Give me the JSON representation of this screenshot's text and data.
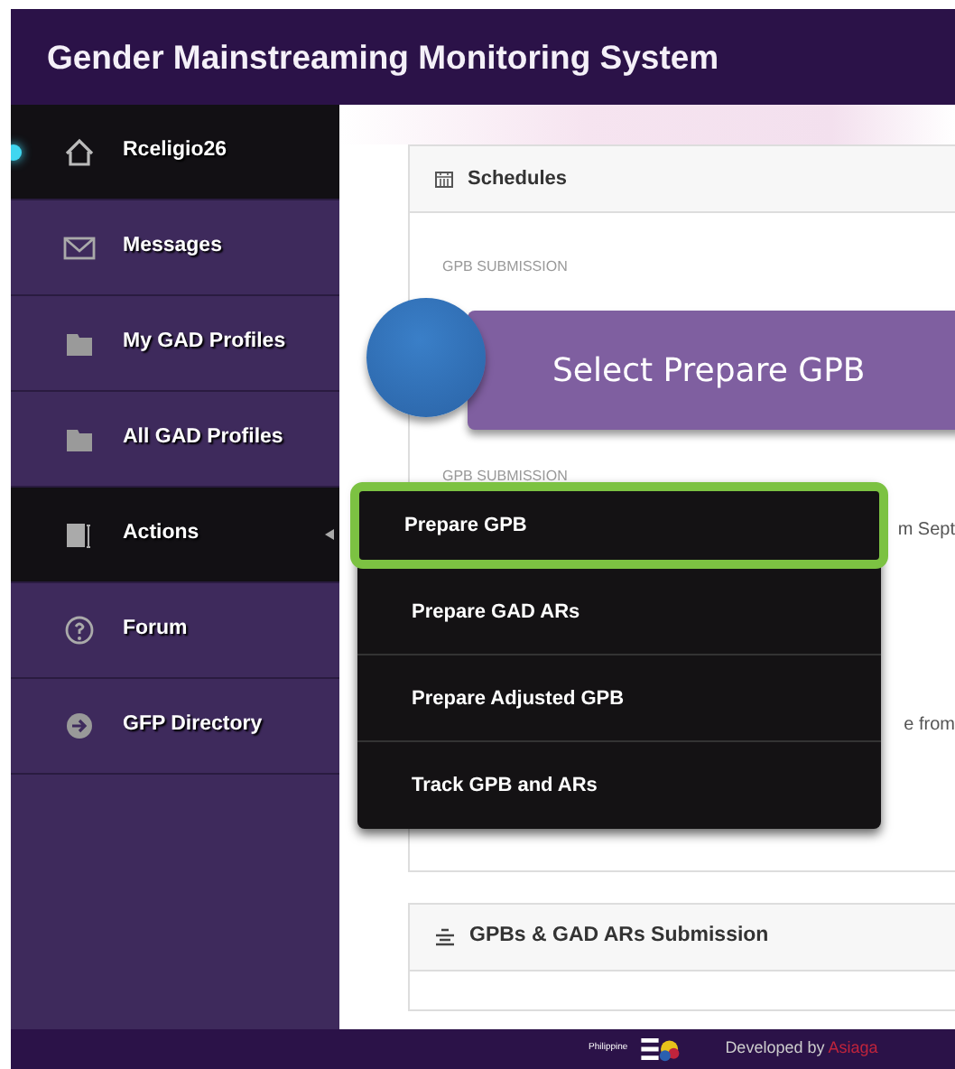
{
  "header": {
    "title": "Gender Mainstreaming Monitoring System"
  },
  "sidebar": {
    "items": [
      {
        "label": "Rceligio26",
        "kind": "home",
        "selected": true
      },
      {
        "label": "Messages",
        "kind": "mail",
        "selected": false
      },
      {
        "label": "My GAD Profiles",
        "kind": "folder",
        "selected": false
      },
      {
        "label": "All GAD Profiles",
        "kind": "folder",
        "selected": false
      },
      {
        "label": "Actions",
        "kind": "actions",
        "selected": true
      },
      {
        "label": "Forum",
        "kind": "help",
        "selected": false
      },
      {
        "label": "GFP Directory",
        "kind": "arrow",
        "selected": false
      }
    ]
  },
  "schedules": {
    "title": "Schedules",
    "labels": [
      "GPB SUBMISSION",
      "GPB SUBMISSION"
    ],
    "fragments": [
      "m Sept",
      "e from"
    ]
  },
  "callout": {
    "text": "Select Prepare GPB"
  },
  "actions_menu": {
    "items": [
      {
        "label": "Prepare GPB",
        "highlighted": true
      },
      {
        "label": "Prepare GAD ARs",
        "highlighted": false
      },
      {
        "label": "Prepare Adjusted GPB",
        "highlighted": false
      },
      {
        "label": "Track GPB and ARs",
        "highlighted": false
      }
    ]
  },
  "submissions_panel": {
    "title": "GPBs & GAD ARs Submission"
  },
  "footer": {
    "logo_text": "Philippine",
    "developed_by": "Developed by",
    "developer": "Asiaga"
  }
}
